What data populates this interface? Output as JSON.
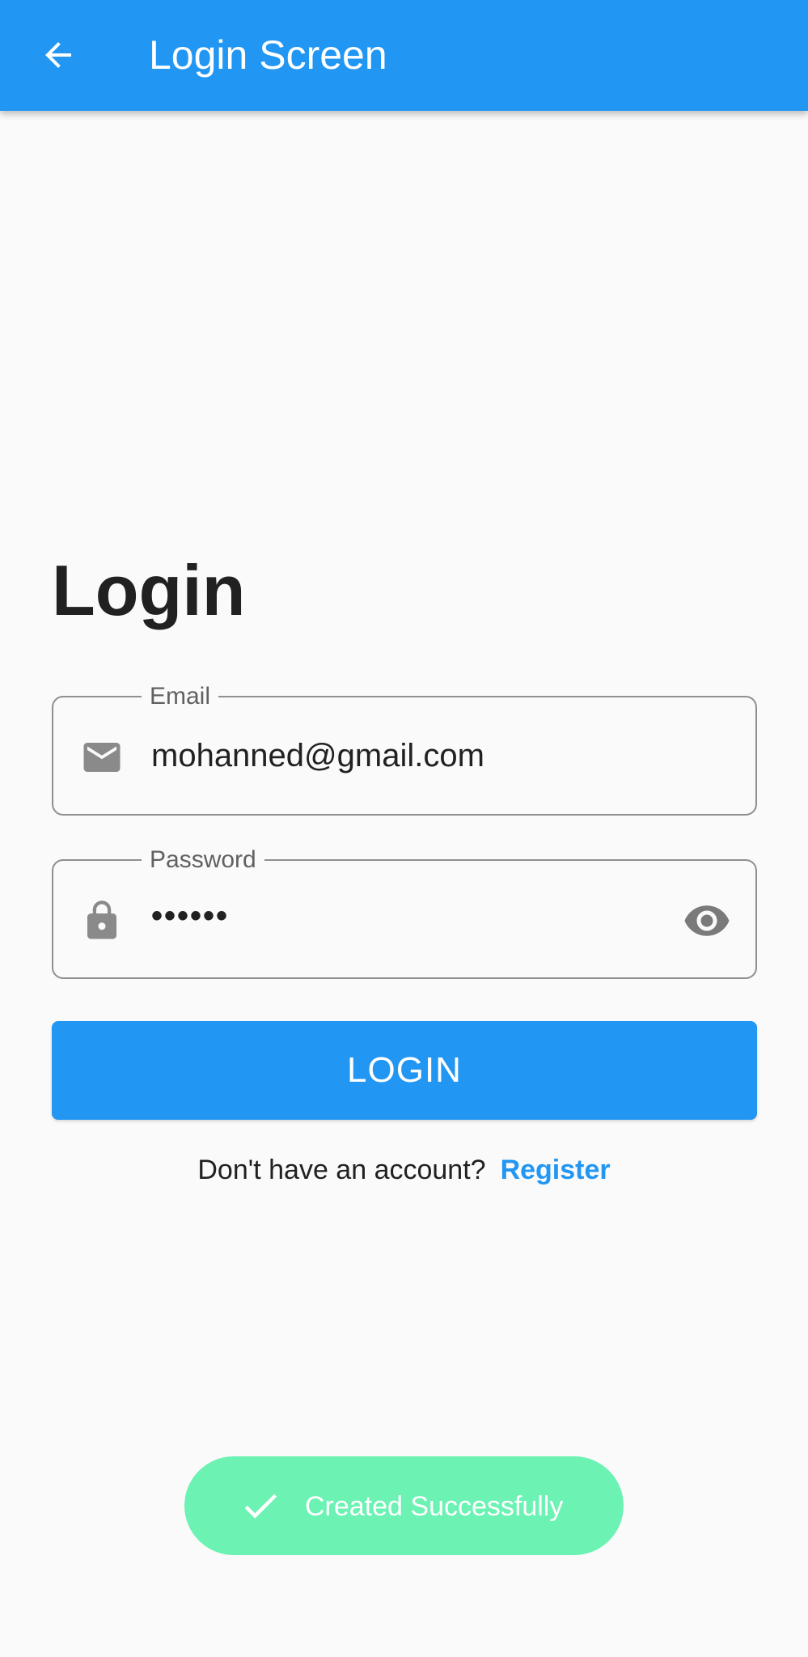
{
  "appbar": {
    "title": "Login Screen",
    "back_icon": "arrow-back-icon",
    "color": "#2196f3"
  },
  "main": {
    "heading": "Login",
    "email": {
      "label": "Email",
      "value": "mohanned@gmail.com",
      "icon": "email-icon"
    },
    "password": {
      "label": "Password",
      "value": "••••••",
      "icon": "lock-icon",
      "visibility_icon": "eye-icon"
    },
    "login_button": {
      "label": "LOGIN"
    },
    "register": {
      "prompt": "Don't have an account?",
      "link": "Register"
    }
  },
  "toast": {
    "message": "Created Successfully",
    "icon": "check-icon",
    "color": "#6cf2b3"
  }
}
